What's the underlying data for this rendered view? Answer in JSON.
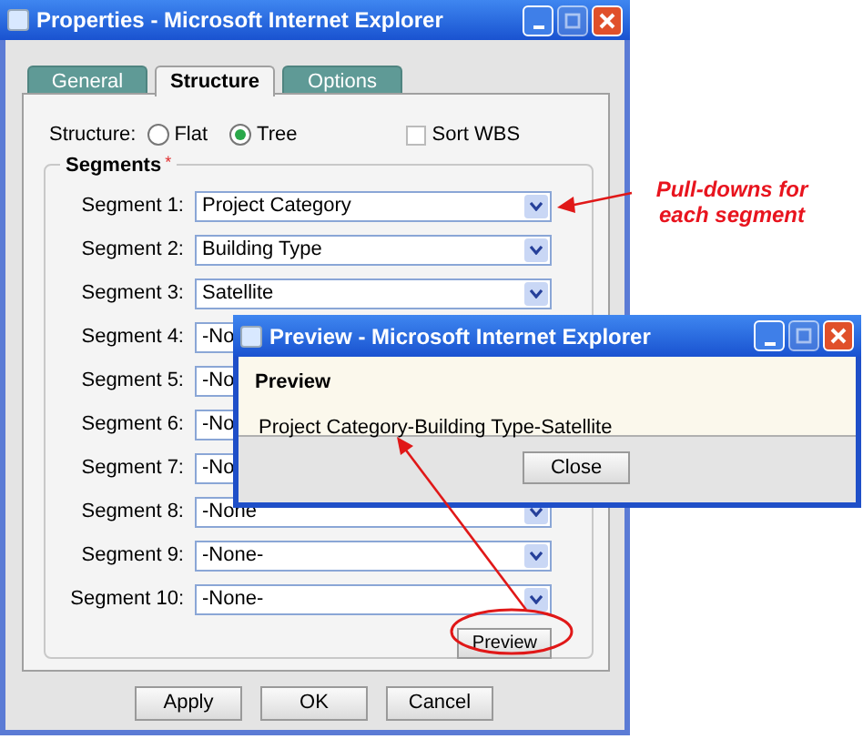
{
  "main_window": {
    "title": "Properties - Microsoft Internet Explorer",
    "tabs": [
      {
        "label": "General",
        "selected": false
      },
      {
        "label": "Structure",
        "selected": true
      },
      {
        "label": "Options",
        "selected": false
      }
    ],
    "structure": {
      "label": "Structure:",
      "options": [
        {
          "label": "Flat",
          "selected": false
        },
        {
          "label": "Tree",
          "selected": true
        }
      ]
    },
    "sort_wbs": {
      "label": "Sort WBS",
      "checked": false
    },
    "segments": {
      "legend": "Segments",
      "required_mark": "*",
      "rows": [
        {
          "label": "Segment 1:",
          "value": "Project Category"
        },
        {
          "label": "Segment 2:",
          "value": "Building Type"
        },
        {
          "label": "Segment 3:",
          "value": "Satellite"
        },
        {
          "label": "Segment 4:",
          "value": "-No",
          "covered": true
        },
        {
          "label": "Segment 5:",
          "value": "-No",
          "covered": true
        },
        {
          "label": "Segment 6:",
          "value": "-No",
          "covered": true
        },
        {
          "label": "Segment 7:",
          "value": "-No",
          "covered": true
        },
        {
          "label": "Segment 8:",
          "value": "-None"
        },
        {
          "label": "Segment 9:",
          "value": "-None-"
        },
        {
          "label": "Segment 10:",
          "value": "-None-"
        }
      ]
    },
    "preview_button": "Preview",
    "buttons": [
      "Apply",
      "OK",
      "Cancel"
    ]
  },
  "preview_window": {
    "title": "Preview - Microsoft Internet Explorer",
    "heading": "Preview",
    "text": "Project Category-Building Type-Satellite",
    "button": "Close"
  },
  "annotation": {
    "text": "Pull-downs for each segment"
  }
}
